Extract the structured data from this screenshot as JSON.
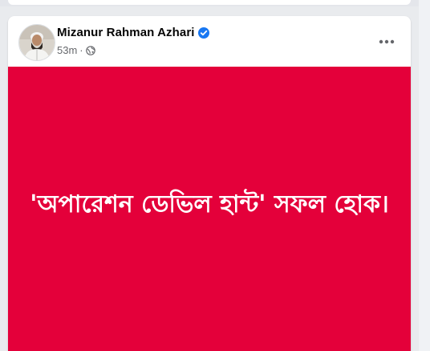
{
  "post": {
    "author": "Mizanur Rahman Azhari",
    "time": "53m",
    "separator": "·",
    "image_text": "'অপারেশন ডেভিল হান্ট' সফল হোক।",
    "image_bg_color": "#e4003a",
    "verified_color": "#1877f2"
  },
  "icons": {
    "verified": "verified-badge-icon",
    "audience": "globe-icon",
    "more": "more-horizontal-icon"
  }
}
